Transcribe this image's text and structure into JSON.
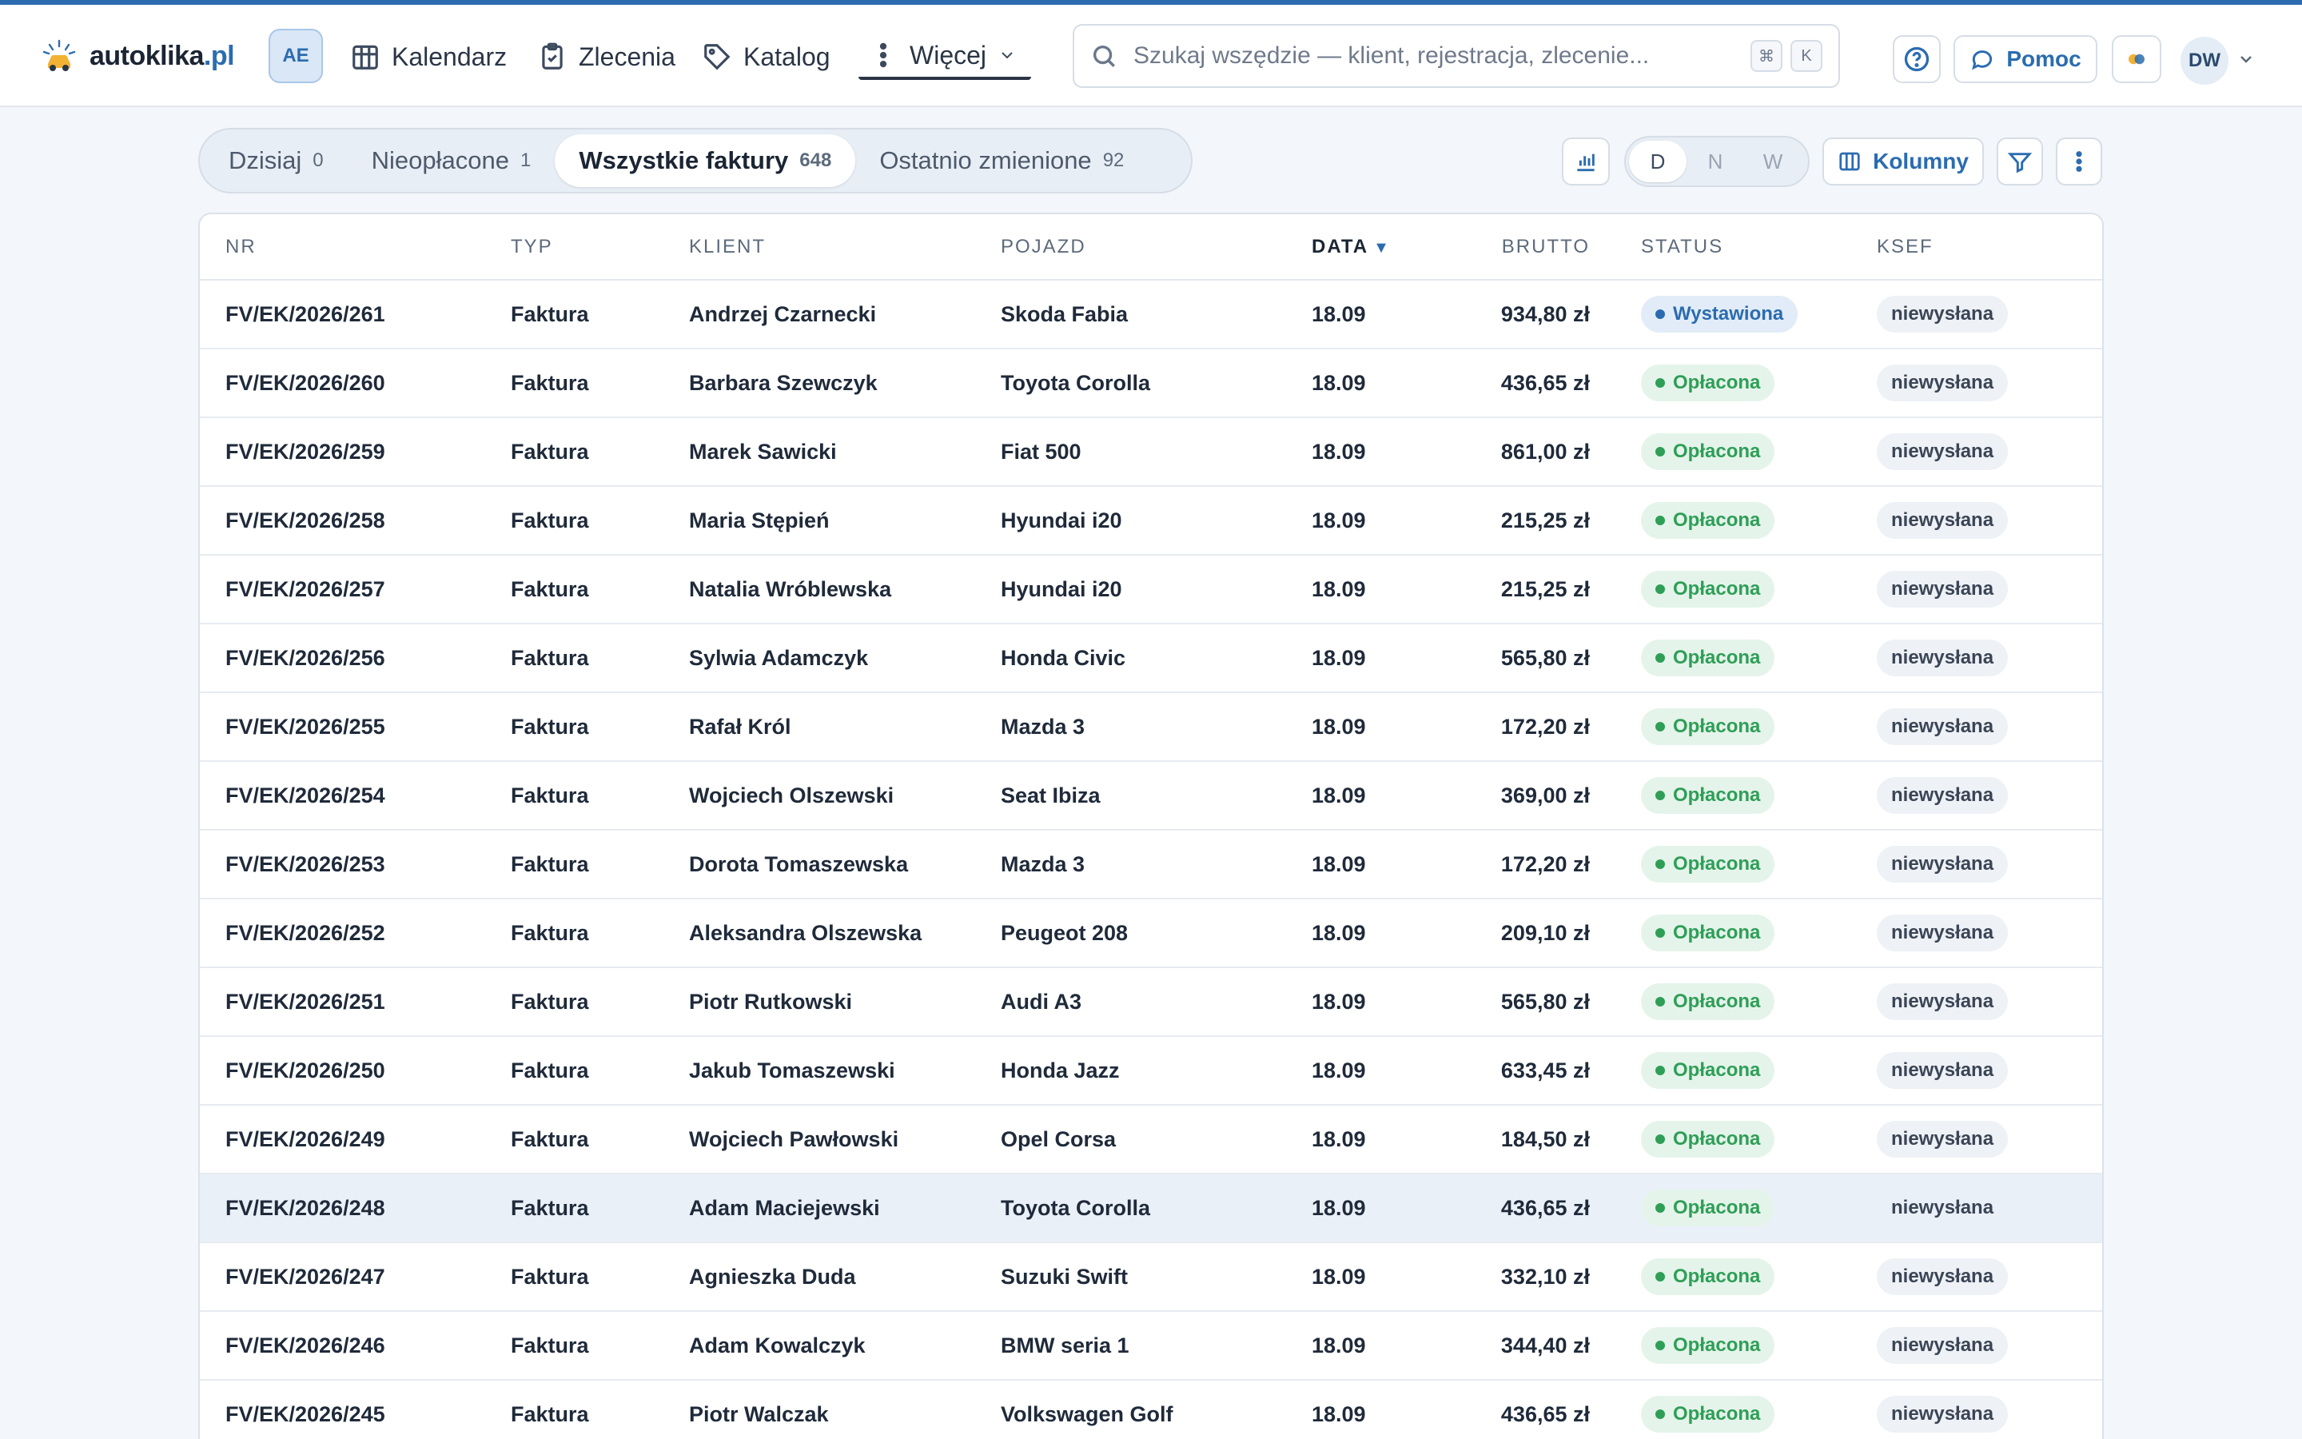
{
  "app": {
    "logo_name": "autoklika",
    "logo_tld": ".pl",
    "workspace_badge": "AE",
    "user_initials": "DW"
  },
  "nav": {
    "calendar": "Kalendarz",
    "orders": "Zlecenia",
    "catalog": "Katalog",
    "more": "Więcej"
  },
  "search": {
    "placeholder": "Szukaj wszędzie — klient, rejestracja, zlecenie...",
    "shortcut_mod": "⌘",
    "shortcut_key": "K"
  },
  "header_actions": {
    "help": "Pomoc"
  },
  "tabs": [
    {
      "label": "Dzisiaj",
      "count": "0"
    },
    {
      "label": "Nieopłacone",
      "count": "1"
    },
    {
      "label": "Wszystkie faktury",
      "count": "648"
    },
    {
      "label": "Ostatnio zmienione",
      "count": "92"
    }
  ],
  "active_tab": 2,
  "view_toggle": {
    "options": [
      "D",
      "N",
      "W"
    ],
    "active": "D"
  },
  "toolbar": {
    "columns": "Kolumny"
  },
  "table": {
    "columns": {
      "nr": "NR",
      "type": "TYP",
      "client": "KLIENT",
      "vehicle": "POJAZD",
      "date": "DATA",
      "gross": "BRUTTO",
      "status": "STATUS",
      "ksef": "KSEF"
    },
    "sort_column": "date",
    "sort_direction": "desc",
    "rows": [
      {
        "nr": "FV/EK/2026/261",
        "type": "Faktura",
        "client": "Andrzej Czarnecki",
        "vehicle": "Skoda Fabia",
        "date": "18.09",
        "gross": "934,80 zł",
        "status": "Wystawiona",
        "status_kind": "issued",
        "ksef": "niewysłana"
      },
      {
        "nr": "FV/EK/2026/260",
        "type": "Faktura",
        "client": "Barbara Szewczyk",
        "vehicle": "Toyota Corolla",
        "date": "18.09",
        "gross": "436,65 zł",
        "status": "Opłacona",
        "status_kind": "paid",
        "ksef": "niewysłana"
      },
      {
        "nr": "FV/EK/2026/259",
        "type": "Faktura",
        "client": "Marek Sawicki",
        "vehicle": "Fiat 500",
        "date": "18.09",
        "gross": "861,00 zł",
        "status": "Opłacona",
        "status_kind": "paid",
        "ksef": "niewysłana"
      },
      {
        "nr": "FV/EK/2026/258",
        "type": "Faktura",
        "client": "Maria Stępień",
        "vehicle": "Hyundai i20",
        "date": "18.09",
        "gross": "215,25 zł",
        "status": "Opłacona",
        "status_kind": "paid",
        "ksef": "niewysłana"
      },
      {
        "nr": "FV/EK/2026/257",
        "type": "Faktura",
        "client": "Natalia Wróblewska",
        "vehicle": "Hyundai i20",
        "date": "18.09",
        "gross": "215,25 zł",
        "status": "Opłacona",
        "status_kind": "paid",
        "ksef": "niewysłana"
      },
      {
        "nr": "FV/EK/2026/256",
        "type": "Faktura",
        "client": "Sylwia Adamczyk",
        "vehicle": "Honda Civic",
        "date": "18.09",
        "gross": "565,80 zł",
        "status": "Opłacona",
        "status_kind": "paid",
        "ksef": "niewysłana"
      },
      {
        "nr": "FV/EK/2026/255",
        "type": "Faktura",
        "client": "Rafał Król",
        "vehicle": "Mazda 3",
        "date": "18.09",
        "gross": "172,20 zł",
        "status": "Opłacona",
        "status_kind": "paid",
        "ksef": "niewysłana"
      },
      {
        "nr": "FV/EK/2026/254",
        "type": "Faktura",
        "client": "Wojciech Olszewski",
        "vehicle": "Seat Ibiza",
        "date": "18.09",
        "gross": "369,00 zł",
        "status": "Opłacona",
        "status_kind": "paid",
        "ksef": "niewysłana"
      },
      {
        "nr": "FV/EK/2026/253",
        "type": "Faktura",
        "client": "Dorota Tomaszewska",
        "vehicle": "Mazda 3",
        "date": "18.09",
        "gross": "172,20 zł",
        "status": "Opłacona",
        "status_kind": "paid",
        "ksef": "niewysłana"
      },
      {
        "nr": "FV/EK/2026/252",
        "type": "Faktura",
        "client": "Aleksandra Olszewska",
        "vehicle": "Peugeot 208",
        "date": "18.09",
        "gross": "209,10 zł",
        "status": "Opłacona",
        "status_kind": "paid",
        "ksef": "niewysłana"
      },
      {
        "nr": "FV/EK/2026/251",
        "type": "Faktura",
        "client": "Piotr Rutkowski",
        "vehicle": "Audi A3",
        "date": "18.09",
        "gross": "565,80 zł",
        "status": "Opłacona",
        "status_kind": "paid",
        "ksef": "niewysłana"
      },
      {
        "nr": "FV/EK/2026/250",
        "type": "Faktura",
        "client": "Jakub Tomaszewski",
        "vehicle": "Honda Jazz",
        "date": "18.09",
        "gross": "633,45 zł",
        "status": "Opłacona",
        "status_kind": "paid",
        "ksef": "niewysłana"
      },
      {
        "nr": "FV/EK/2026/249",
        "type": "Faktura",
        "client": "Wojciech Pawłowski",
        "vehicle": "Opel Corsa",
        "date": "18.09",
        "gross": "184,50 zł",
        "status": "Opłacona",
        "status_kind": "paid",
        "ksef": "niewysłana"
      },
      {
        "nr": "FV/EK/2026/248",
        "type": "Faktura",
        "client": "Adam Maciejewski",
        "vehicle": "Toyota Corolla",
        "date": "18.09",
        "gross": "436,65 zł",
        "status": "Opłacona",
        "status_kind": "paid",
        "ksef": "niewysłana",
        "selected": true
      },
      {
        "nr": "FV/EK/2026/247",
        "type": "Faktura",
        "client": "Agnieszka Duda",
        "vehicle": "Suzuki Swift",
        "date": "18.09",
        "gross": "332,10 zł",
        "status": "Opłacona",
        "status_kind": "paid",
        "ksef": "niewysłana"
      },
      {
        "nr": "FV/EK/2026/246",
        "type": "Faktura",
        "client": "Adam Kowalczyk",
        "vehicle": "BMW seria 1",
        "date": "18.09",
        "gross": "344,40 zł",
        "status": "Opłacona",
        "status_kind": "paid",
        "ksef": "niewysłana"
      },
      {
        "nr": "FV/EK/2026/245",
        "type": "Faktura",
        "client": "Piotr Walczak",
        "vehicle": "Volkswagen Golf",
        "date": "18.09",
        "gross": "436,65 zł",
        "status": "Opłacona",
        "status_kind": "paid",
        "ksef": "niewysłana"
      }
    ]
  },
  "colors": {
    "accent": "#2b6cb0",
    "paid": "#2f9e57",
    "issued": "#2b6cb0",
    "selected_row": "#eaf0f8"
  }
}
